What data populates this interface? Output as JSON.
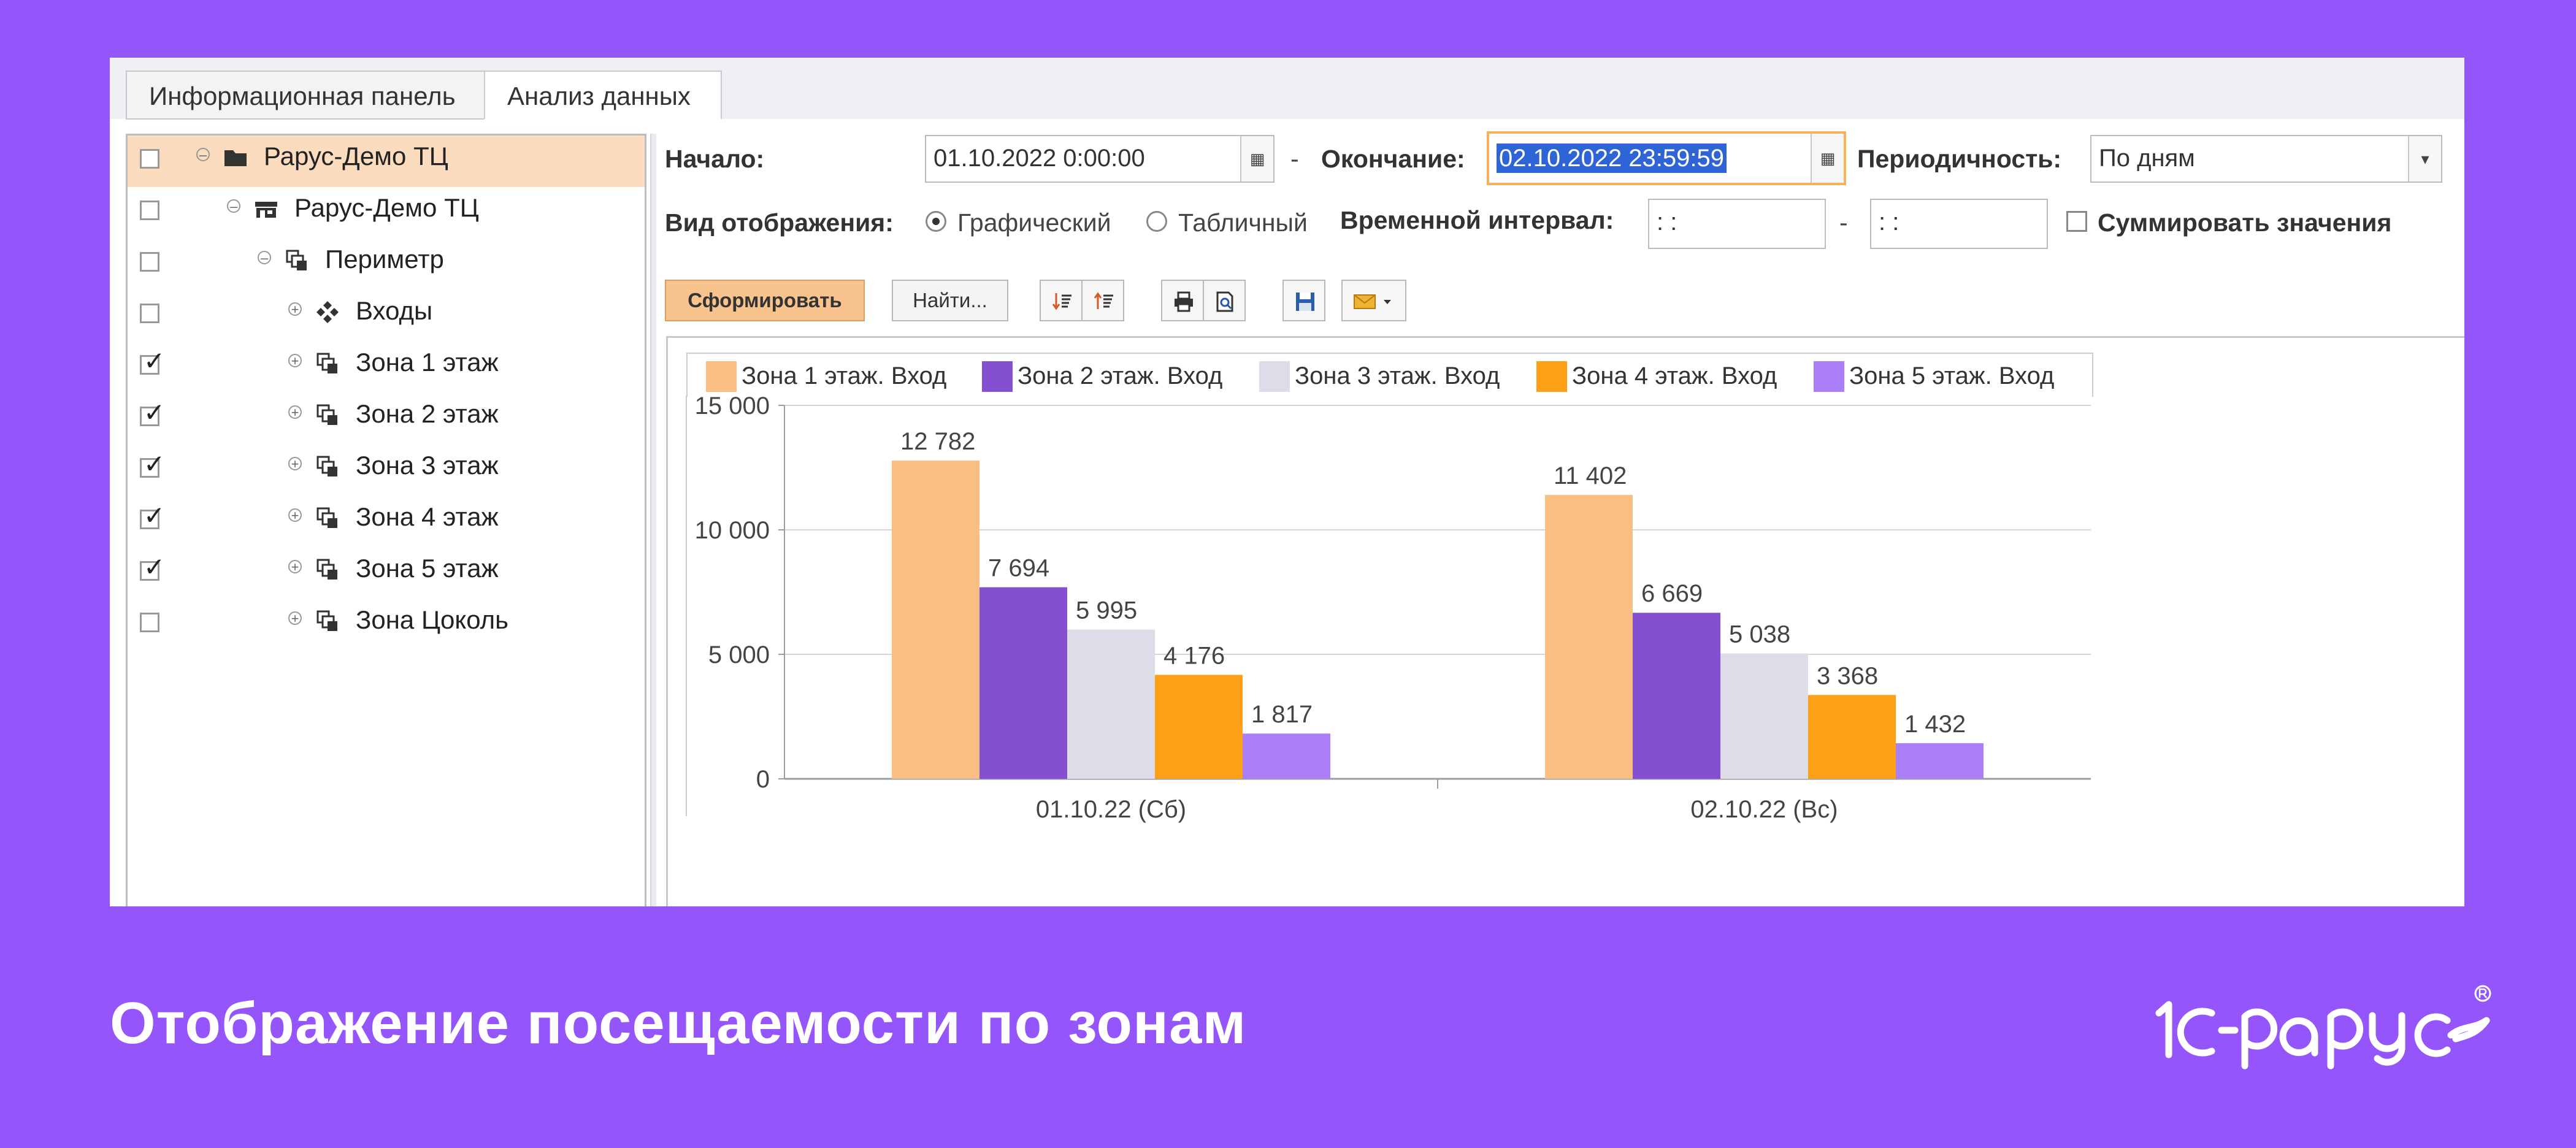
{
  "tabs": [
    {
      "label": "Информационная панель"
    },
    {
      "label": "Анализ данных"
    }
  ],
  "tree": [
    {
      "label": "Рарус-Демо ТЦ",
      "checked": false,
      "selected": true,
      "icon": "folder-icon",
      "expander": "collapse"
    },
    {
      "label": "Рарус-Демо ТЦ",
      "checked": false,
      "selected": false,
      "icon": "building-icon",
      "expander": "collapse"
    },
    {
      "label": "Периметр",
      "checked": false,
      "selected": false,
      "icon": "zone-icon",
      "expander": "collapse"
    },
    {
      "label": "Входы",
      "checked": false,
      "selected": false,
      "icon": "entrances-icon",
      "expander": "expand"
    },
    {
      "label": "Зона 1 этаж",
      "checked": true,
      "selected": false,
      "icon": "zone-icon",
      "expander": "expand"
    },
    {
      "label": "Зона 2 этаж",
      "checked": true,
      "selected": false,
      "icon": "zone-icon",
      "expander": "expand"
    },
    {
      "label": "Зона 3 этаж",
      "checked": true,
      "selected": false,
      "icon": "zone-icon",
      "expander": "expand"
    },
    {
      "label": "Зона 4 этаж",
      "checked": true,
      "selected": false,
      "icon": "zone-icon",
      "expander": "expand"
    },
    {
      "label": "Зона 5 этаж",
      "checked": true,
      "selected": false,
      "icon": "zone-icon",
      "expander": "expand"
    },
    {
      "label": "Зона Цоколь",
      "checked": false,
      "selected": false,
      "icon": "zone-icon",
      "expander": "expand"
    }
  ],
  "filters": {
    "start_label": "Начало:",
    "start_value": "01.10.2022  0:00:00",
    "dash": "-",
    "end_label": "Окончание:",
    "end_value": "02.10.2022 23:59:59",
    "period_label": "Периодичность:",
    "period_value": "По дням",
    "view_label": "Вид отображения:",
    "view_graphic": "Графический",
    "view_table": "Табличный",
    "interval_label": "Временной интервал:",
    "interval_from": " :  : ",
    "interval_to": " :  : ",
    "sum_label": "Суммировать значения"
  },
  "toolbar": {
    "generate": "Сформировать",
    "find": "Найти..."
  },
  "caption": "Отображение посещаемости по зонам",
  "colors": {
    "zone1": "#f9be82",
    "zone2": "#8450d1",
    "zone3": "#dcdde8",
    "zone4": "#fd9f17",
    "zone5": "#a97ef6",
    "background": "#9456fb",
    "selected_row": "#fbdcbf"
  },
  "chart_data": {
    "type": "bar",
    "categories": [
      "01.10.22 (Сб)",
      "02.10.22 (Вс)"
    ],
    "series": [
      {
        "name": "Зона 1 этаж. Вход",
        "values": [
          12782,
          11402
        ],
        "labels": [
          "12 782",
          "11 402"
        ]
      },
      {
        "name": "Зона 2 этаж. Вход",
        "values": [
          7694,
          6669
        ],
        "labels": [
          "7 694",
          "6 669"
        ]
      },
      {
        "name": "Зона 3 этаж. Вход",
        "values": [
          5995,
          5038
        ],
        "labels": [
          "5 995",
          "5 038"
        ]
      },
      {
        "name": "Зона 4 этаж. Вход",
        "values": [
          4176,
          3368
        ],
        "labels": [
          "4 176",
          "3 368"
        ]
      },
      {
        "name": "Зона 5 этаж. Вход",
        "values": [
          1817,
          1432
        ],
        "labels": [
          "1 817",
          "1 432"
        ]
      }
    ],
    "yticks": [
      0,
      5000,
      10000,
      15000
    ],
    "ytick_labels": [
      "0",
      "5 000",
      "10 000",
      "15 000"
    ],
    "ylim": [
      0,
      15000
    ],
    "grid": true,
    "legend": "top"
  }
}
